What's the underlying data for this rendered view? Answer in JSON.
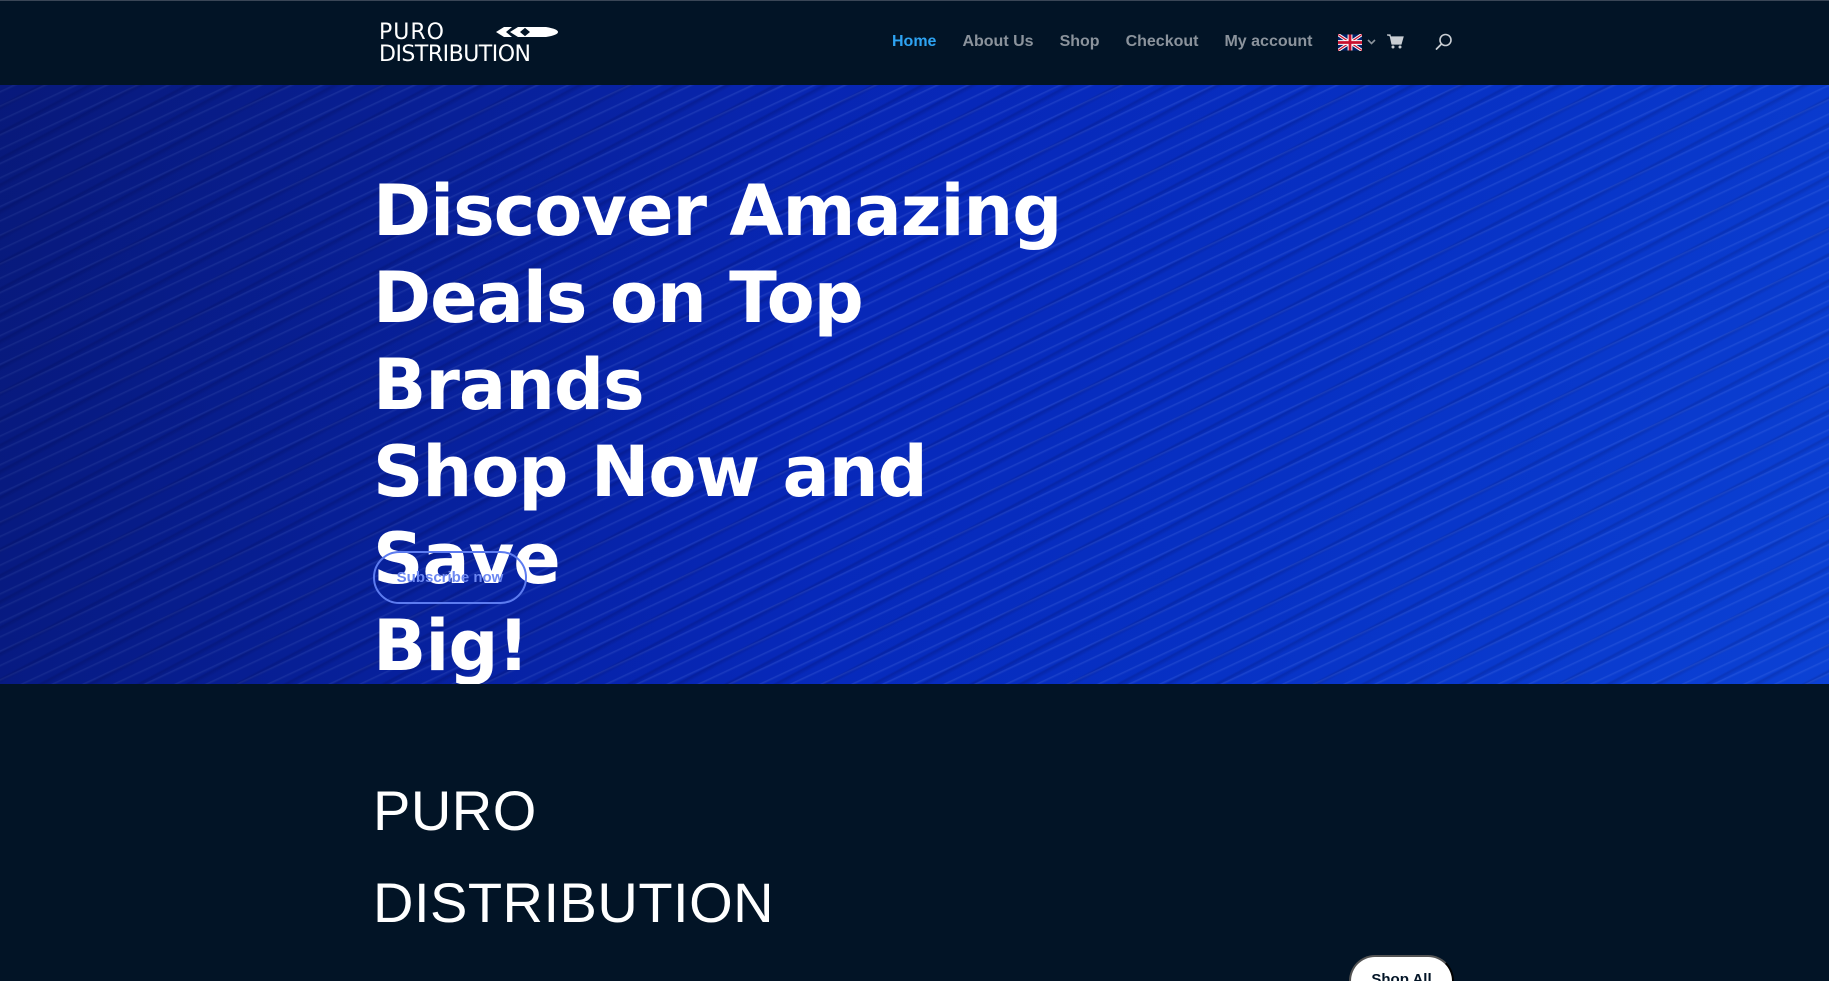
{
  "header": {
    "logo_line1": "PURO",
    "logo_line2": "DISTRIBUTION",
    "nav": [
      {
        "label": "Home",
        "active": true
      },
      {
        "label": "About Us",
        "active": false
      },
      {
        "label": "Shop",
        "active": false
      },
      {
        "label": "Checkout",
        "active": false
      },
      {
        "label": "My account",
        "active": false
      }
    ],
    "language": "en-GB",
    "language_icon": "uk-flag-icon",
    "cart_icon": "cart-icon",
    "search_icon": "search-icon"
  },
  "hero": {
    "title": "Discover Amazing\nDeals on Top Brands\nShop Now and Save\nBig!",
    "cta_label": "Subscribe now"
  },
  "section": {
    "heading_line1": "PURO",
    "heading_line2": "DISTRIBUTION",
    "shop_all_label": "Shop All"
  },
  "colors": {
    "header_bg": "#021426",
    "nav_text": "#8b939c",
    "nav_active": "#2ea3f2",
    "hero_blue": "#0727b8",
    "cta_border": "#5d7cf0",
    "page_bg": "#021426"
  }
}
